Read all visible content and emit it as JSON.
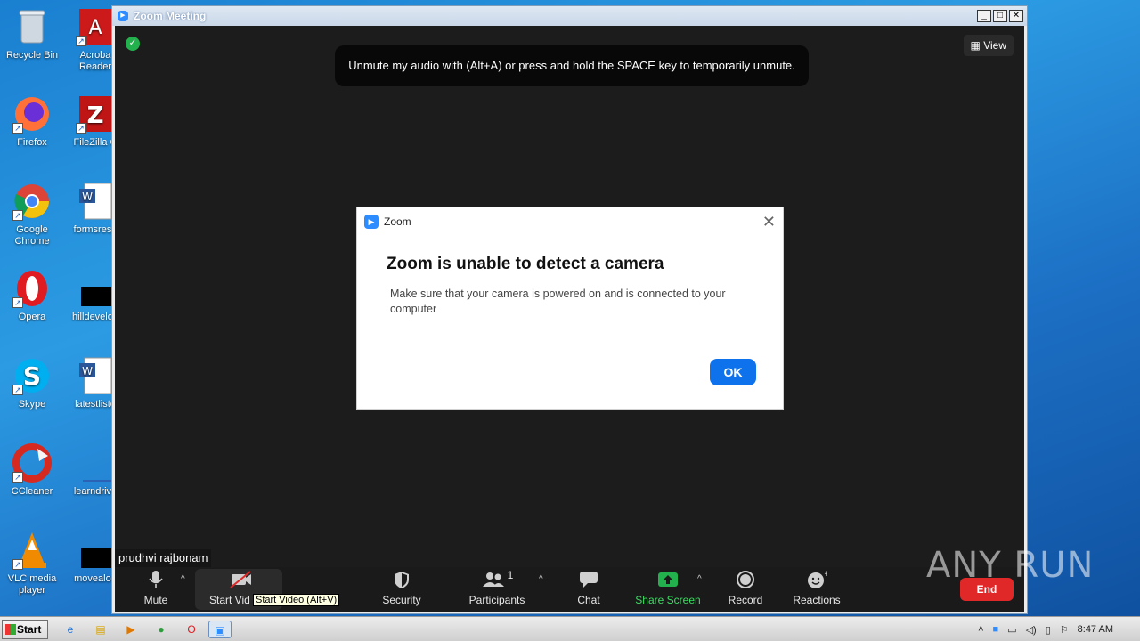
{
  "desktop": {
    "icons": [
      {
        "label": "Recycle Bin",
        "icon": "recycle-bin-icon"
      },
      {
        "label": "Acroba\nReader",
        "icon": "acrobat-icon"
      },
      {
        "label": "Firefox",
        "icon": "firefox-icon"
      },
      {
        "label": "FileZilla C",
        "icon": "filezilla-icon"
      },
      {
        "label": "Google\nChrome",
        "icon": "chrome-icon"
      },
      {
        "label": "formsresp",
        "icon": "word-doc-icon"
      },
      {
        "label": "Opera",
        "icon": "opera-icon"
      },
      {
        "label": "hilldevelop",
        "icon": "file-icon"
      },
      {
        "label": "Skype",
        "icon": "skype-icon"
      },
      {
        "label": "latestliste",
        "icon": "word-doc-icon"
      },
      {
        "label": "CCleaner",
        "icon": "ccleaner-icon"
      },
      {
        "label": "learndrive",
        "icon": "file-icon"
      },
      {
        "label": "VLC media\nplayer",
        "icon": "vlc-icon"
      },
      {
        "label": "movealon",
        "icon": "file-icon"
      }
    ]
  },
  "zoom_window": {
    "title": "Zoom Meeting",
    "view_label": "View",
    "toast_text": "Unmute my audio with (Alt+A) or press and hold the SPACE key to temporarily unmute.",
    "participant_name": "prudhvi rajbonam",
    "toolbar": {
      "mute_label": "Mute",
      "start_video_label": "Start Vid",
      "security_label": "Security",
      "participants_label": "Participants",
      "participants_count": "1",
      "chat_label": "Chat",
      "share_screen_label": "Share Screen",
      "record_label": "Record",
      "reactions_label": "Reactions",
      "end_label": "End"
    },
    "tooltip": "Start Video (Alt+V)"
  },
  "dialog": {
    "app_name": "Zoom",
    "title": "Zoom is unable to detect a camera",
    "message": "Make sure that your camera is powered on and is connected to your computer",
    "ok_label": "OK"
  },
  "watermark": "ANY RUN",
  "taskbar": {
    "start_label": "Start",
    "clock": "8:47 AM"
  },
  "colors": {
    "zoom_blue": "#0e72ed",
    "share_green": "#3ddc63",
    "end_red": "#e02828",
    "meeting_bg": "#1c1c1c"
  }
}
